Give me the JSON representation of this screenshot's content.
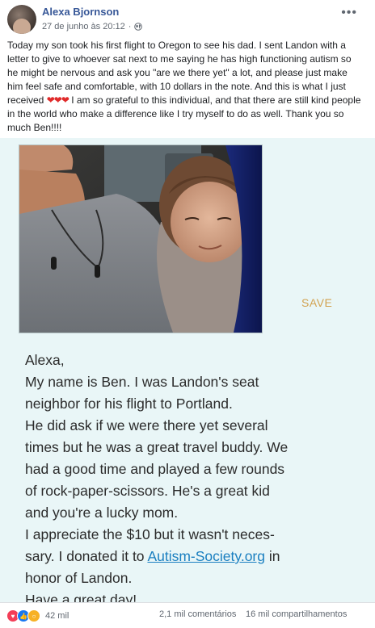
{
  "post": {
    "author": "Alexa Bjornson",
    "timestamp": "27 de junho às 20:12",
    "privacy_icon": "globe-icon",
    "more_icon": "more-options-icon",
    "more_label": "•••",
    "text_before_hearts": "Today my son took his first flight to Oregon to see his dad. I sent Landon with a letter to give to whoever sat next to me saying he has high functioning autism so he might be nervous and ask you \"are we there yet\" a lot, and please just make him feel safe and comfortable, with 10 dollars in the note. And this is what I just received",
    "hearts": "❤❤❤",
    "text_after_hearts": " I am so grateful to this individual, and that there are still kind people in the world who make a difference like I try myself to do as well. Thank you so much Ben!!!!"
  },
  "image": {
    "save_label": "SAVE",
    "letter": {
      "l1": "Alexa,",
      "l2": "My name is Ben. I was Landon's seat",
      "l3": "neighbor for his flight to Portland.",
      "l4": "He did ask if we were there yet several",
      "l5": "times but he was a great travel buddy. We",
      "l6": "had a good time and played a few rounds",
      "l7": "of rock-paper-scissors. He's a great kid",
      "l8": "and you're a lucky mom.",
      "l9": "I appreciate the $10 but it wasn't neces-",
      "l10_before": "sary. I donated it to ",
      "l10_link": "Autism-Society.org",
      "l10_after": " in",
      "l11": "honor of Landon.",
      "l12": "Have a great day!"
    }
  },
  "footer": {
    "reaction_count": "42 mil",
    "comments": "2,1 mil comentários",
    "shares": "16 mil compartilhamentos"
  },
  "colors": {
    "author_link": "#385898",
    "heart": "#e02a2a",
    "save": "#d2a352",
    "link": "#1a7fc0",
    "letter_bg": "#e9f6f7"
  }
}
